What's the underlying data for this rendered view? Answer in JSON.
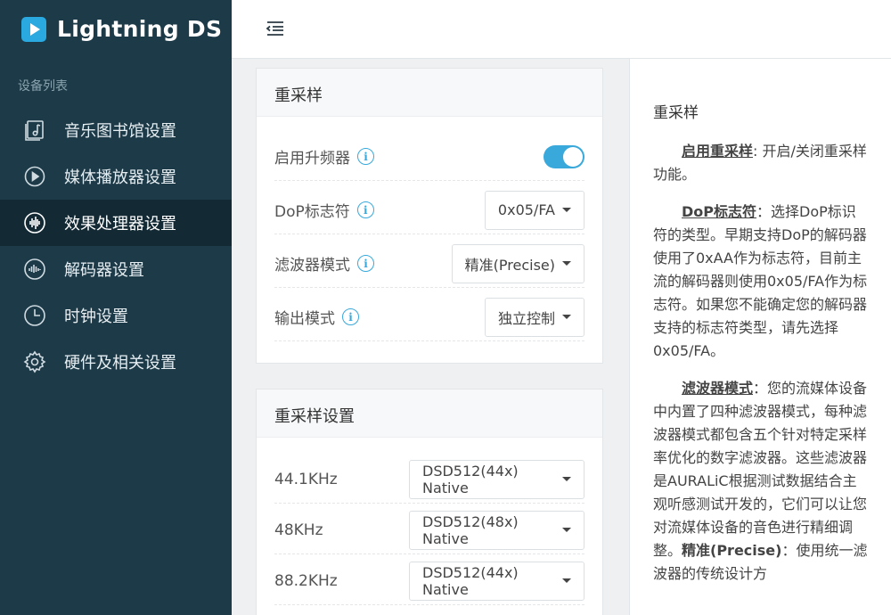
{
  "app": {
    "name": "Lightning DS"
  },
  "sidebar": {
    "section_label": "设备列表",
    "items": [
      {
        "label": "音乐图书馆设置",
        "icon": "music-library-icon"
      },
      {
        "label": "媒体播放器设置",
        "icon": "play-circle-icon"
      },
      {
        "label": "效果处理器设置",
        "icon": "waveform-icon",
        "active": true
      },
      {
        "label": "解码器设置",
        "icon": "decoder-icon"
      },
      {
        "label": "时钟设置",
        "icon": "clock-icon"
      },
      {
        "label": "硬件及相关设置",
        "icon": "gear-icon"
      }
    ]
  },
  "resampling": {
    "title": "重采样",
    "rows": [
      {
        "label": "启用升频器",
        "control": "toggle",
        "value": true
      },
      {
        "label": "DoP标志符",
        "control": "select",
        "value": "0x05/FA"
      },
      {
        "label": "滤波器模式",
        "control": "select",
        "value": "精准(Precise)"
      },
      {
        "label": "输出模式",
        "control": "select",
        "value": "独立控制"
      }
    ]
  },
  "resampling_settings": {
    "title": "重采样设置",
    "rows": [
      {
        "label": "44.1KHz",
        "value": "DSD512(44x) Native"
      },
      {
        "label": "48KHz",
        "value": "DSD512(48x) Native"
      },
      {
        "label": "88.2KHz",
        "value": "DSD512(44x) Native"
      }
    ]
  },
  "help": {
    "title": "重采样",
    "p1_term": "启用重采样",
    "p1_text": ": 开启/关闭重采样功能。",
    "p2_term": "DoP标志符",
    "p2_text": "：选择DoP标识符的类型。早期支持DoP的解码器使用了0xAA作为标志符，目前主流的解码器则使用0x05/FA作为标志符。如果您不能确定您的解码器支持的标志符类型，请先选择0x05/FA。",
    "p3_term": "滤波器模式",
    "p3_text": "：您的流媒体设备中内置了四种滤波器模式，每种滤波器模式都包含五个针对特定采样率优化的数字滤波器。这些滤波器是AURALiC根据测试数据结合主观听感测试开发的，它们可以让您对流媒体设备的音色进行精细调整。",
    "p3_bold": "精准(Precise)",
    "p3_tail": "：使用统一滤波器的传统设计方"
  }
}
